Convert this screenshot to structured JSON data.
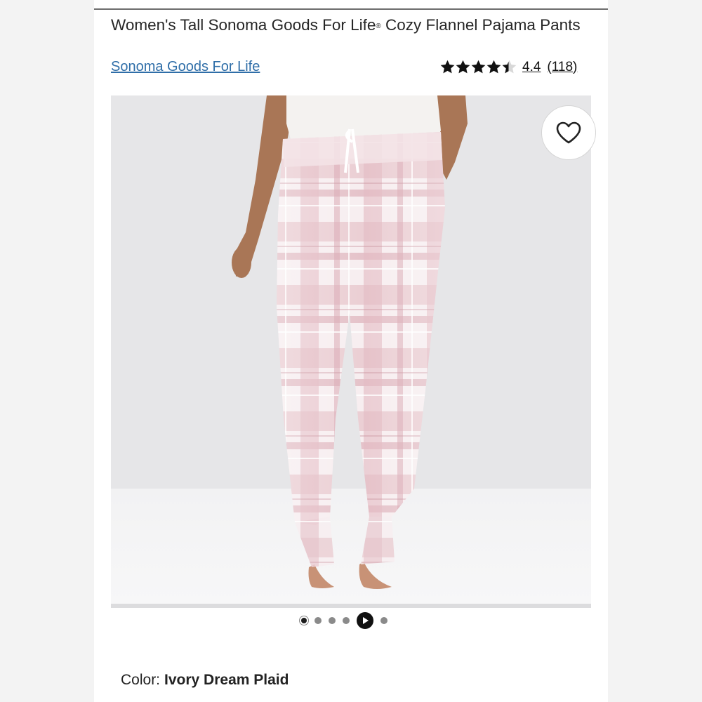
{
  "product": {
    "title_main": "Women's Tall Sonoma Goods For Life",
    "title_mark": "®",
    "title_rest": " Cozy Flannel Pajama Pants",
    "brand": "Sonoma Goods For Life"
  },
  "rating": {
    "value": "4.4",
    "count": "(118)",
    "stars_filled_fraction": 0.88
  },
  "gallery": {
    "dots": [
      "image-1",
      "image-2",
      "image-3",
      "image-4",
      "video",
      "image-6"
    ],
    "active_index": 0,
    "favorite_icon": "heart-outline-icon"
  },
  "color": {
    "label": "Color:",
    "value": "Ivory Dream Plaid"
  },
  "colors": {
    "link": "#2f6ea8",
    "plaid_pink": "#d9a6b0",
    "plaid_ivory": "#f7eef0"
  }
}
